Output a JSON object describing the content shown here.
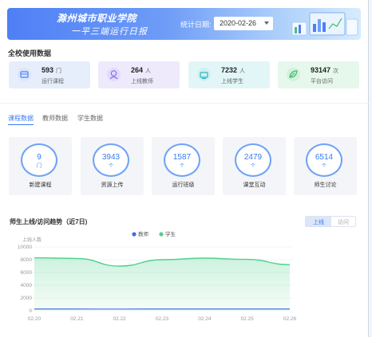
{
  "banner": {
    "title": "滁州城市职业学院",
    "subtitle": "一平三端运行日报",
    "date_label": "统计日期:",
    "date_value": "2020-02-26"
  },
  "school_stats": {
    "title": "全校使用数据",
    "items": [
      {
        "value": "593",
        "unit": "门",
        "label": "运行课程",
        "icon": "course-icon",
        "color": "#4f7ff5"
      },
      {
        "value": "264",
        "unit": "人",
        "label": "上线教师",
        "icon": "teacher-icon",
        "color": "#8a6cf0"
      },
      {
        "value": "7232",
        "unit": "人",
        "label": "上线学生",
        "icon": "student-icon",
        "color": "#27b6c4"
      },
      {
        "value": "93147",
        "unit": "次",
        "label": "平台访问",
        "icon": "visit-icon",
        "color": "#3cbf6a"
      }
    ]
  },
  "tabs": [
    {
      "label": "课程数据",
      "active": true
    },
    {
      "label": "教师数据",
      "active": false
    },
    {
      "label": "学生数据",
      "active": false
    }
  ],
  "course_metrics": [
    {
      "value": "9",
      "unit": "门",
      "label": "新建课程"
    },
    {
      "value": "3943",
      "unit": "个",
      "label": "资源上传"
    },
    {
      "value": "1587",
      "unit": "个",
      "label": "运行班级"
    },
    {
      "value": "2479",
      "unit": "个",
      "label": "课堂互动"
    },
    {
      "value": "6514",
      "unit": "个",
      "label": "师生讨论"
    }
  ],
  "trend": {
    "title": "师生上线/访问趋势（近7日)",
    "toggle_on": "上线",
    "toggle_off": "访问"
  },
  "chart_data": {
    "type": "area",
    "ylabel": "上线人数",
    "ylim": [
      0,
      10000
    ],
    "yticks": [
      "10000",
      "8000",
      "6000",
      "4000",
      "2000",
      "0"
    ],
    "categories": [
      "02.20",
      "02.21",
      "02.22",
      "02.23",
      "02.24",
      "02.25",
      "02.26"
    ],
    "legend_position": "top-center",
    "series": [
      {
        "name": "教师",
        "color": "#3f6fe0",
        "values": [
          270,
          265,
          255,
          268,
          270,
          266,
          264
        ]
      },
      {
        "name": "学生",
        "color": "#4fd18b",
        "values": [
          8300,
          8200,
          7000,
          8000,
          8250,
          8050,
          7232
        ]
      }
    ]
  }
}
